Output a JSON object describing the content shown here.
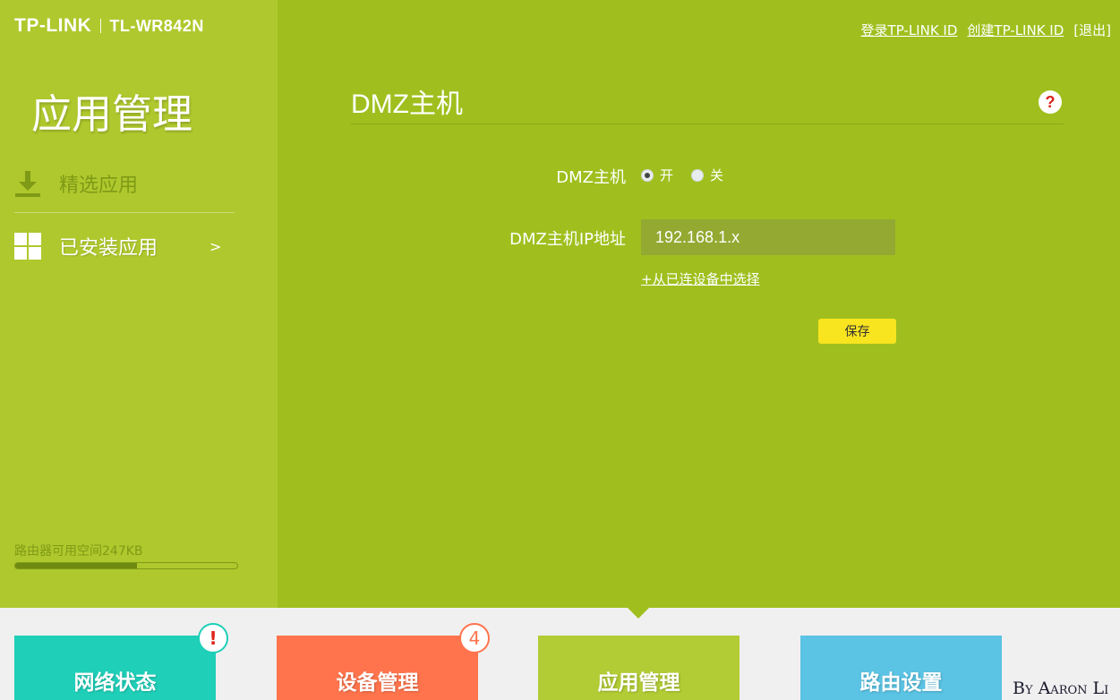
{
  "brand": {
    "logo": "TP-LINK",
    "model": "TL-WR842N"
  },
  "top_links": {
    "login": "登录TP-LINK ID",
    "create": "创建TP-LINK ID",
    "logout": "[退出]"
  },
  "sidebar": {
    "title": "应用管理",
    "items": [
      {
        "label": "精选应用",
        "icon": "download-icon"
      },
      {
        "label": "已安装应用",
        "icon": "grid-icon",
        "chevron": ">"
      }
    ],
    "storage": {
      "label": "路由器可用空间247KB",
      "used_fraction": 0.55
    }
  },
  "main": {
    "title": "DMZ主机",
    "help": "?",
    "form": {
      "dmz_label": "DMZ主机",
      "radio_on": "开",
      "radio_off": "关",
      "selected": "on",
      "ip_label": "DMZ主机IP地址",
      "ip_value": "192.168.1.x",
      "select_link": "+从已连设备中选择",
      "save_label": "保存"
    }
  },
  "bottom_nav": [
    {
      "label": "网络状态",
      "badge": "!",
      "color": "#1fcfb8"
    },
    {
      "label": "设备管理",
      "badge": "4",
      "color": "#ff744c"
    },
    {
      "label": "应用管理",
      "color": "#b2cc35",
      "active": true
    },
    {
      "label": "路由设置",
      "color": "#5bc3e3"
    }
  ],
  "watermark": "By Aaron Li"
}
